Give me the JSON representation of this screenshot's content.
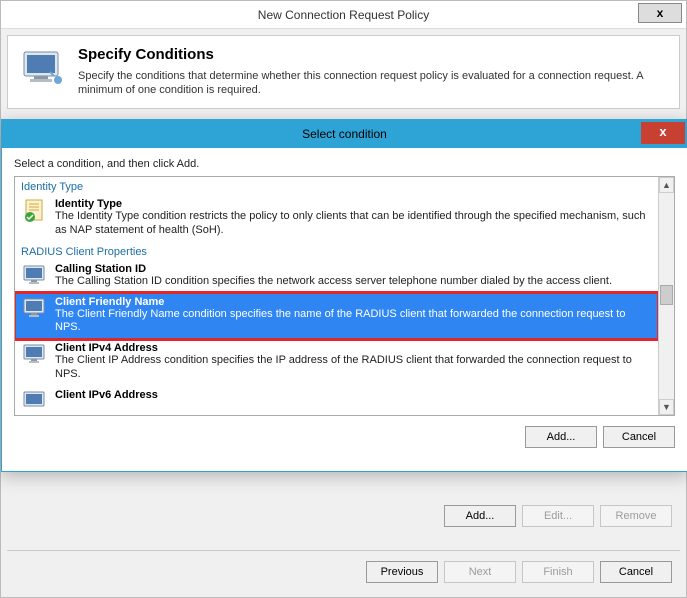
{
  "parent": {
    "title": "New Connection Request Policy",
    "close": "x",
    "header": {
      "heading": "Specify Conditions",
      "description": "Specify the conditions that determine whether this connection request policy is evaluated for a connection request. A minimum of one condition is required."
    },
    "buttons": {
      "add": "Add...",
      "edit": "Edit...",
      "remove": "Remove"
    },
    "footer": {
      "previous": "Previous",
      "next": "Next",
      "finish": "Finish",
      "cancel": "Cancel"
    }
  },
  "modal": {
    "title": "Select condition",
    "close": "x",
    "instruction": "Select a condition, and then click Add.",
    "groups": [
      {
        "name": "Identity Type",
        "items": [
          {
            "id": "identity-type",
            "title": "Identity Type",
            "desc": "The Identity Type condition restricts the policy to only clients that can be identified through the specified mechanism, such as NAP statement of health (SoH).",
            "selected": false
          }
        ]
      },
      {
        "name": "RADIUS Client Properties",
        "items": [
          {
            "id": "calling-station-id",
            "title": "Calling Station ID",
            "desc": "The Calling Station ID condition specifies the network access server telephone number dialed by the access client.",
            "selected": false
          },
          {
            "id": "client-friendly-name",
            "title": "Client Friendly Name",
            "desc": "The Client Friendly Name condition specifies the name of the RADIUS client that forwarded the connection request to NPS.",
            "selected": true
          },
          {
            "id": "client-ipv4-address",
            "title": "Client IPv4 Address",
            "desc": "The Client IP Address condition specifies the IP address of the RADIUS client that forwarded the connection request to NPS.",
            "selected": false
          },
          {
            "id": "client-ipv6-address",
            "title": "Client IPv6 Address",
            "desc": "",
            "selected": false
          }
        ]
      }
    ],
    "buttons": {
      "add": "Add...",
      "cancel": "Cancel"
    }
  }
}
